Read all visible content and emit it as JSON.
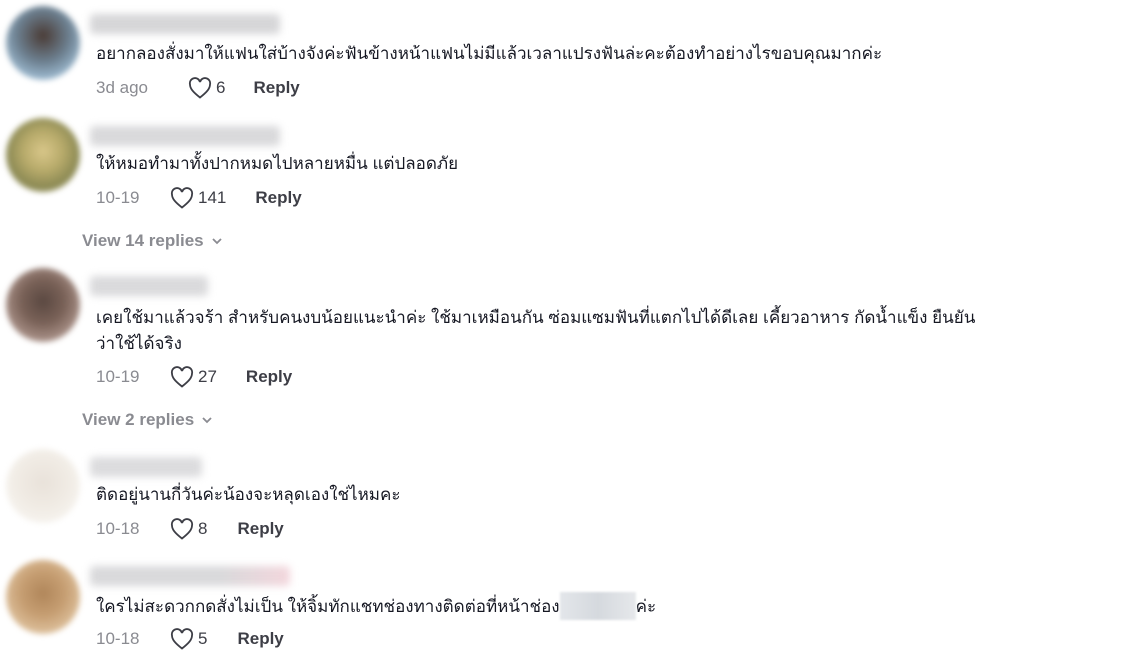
{
  "comments": [
    {
      "text": "อยากลองสั่งมาให้แฟนใส่บ้างจังค่ะฟันข้างหน้าแฟนไม่มีแล้วเวลาแปรงฟันล่ะคะต้องทำอย่างไรขอบคุณมากค่ะ",
      "time": "3d ago",
      "likes": "6",
      "reply_label": "Reply"
    },
    {
      "text": "ให้หมอทำมาทั้งปากหมดไปหลายหมื่น แต่ปลอดภัย",
      "time": "10-19",
      "likes": "141",
      "reply_label": "Reply",
      "view_replies": "View 14 replies"
    },
    {
      "text": "เคยใช้มาแล้วจร้า สำหรับคนงบน้อยแนะนำค่ะ ใช้มาเหมือนกัน ซ่อมแซมฟันที่แตกไปได้ดีเลย เคี้ยวอาหาร กัดน้ำแข็ง ยืนยัน\nว่าใช้ได้จริง",
      "time": "10-19",
      "likes": "27",
      "reply_label": "Reply",
      "view_replies": "View 2 replies"
    },
    {
      "text": "ติดอยู่นานกี่วันค่ะน้องจะหลุดเองใช่ไหมคะ",
      "time": "10-18",
      "likes": "8",
      "reply_label": "Reply"
    },
    {
      "text_before": "ใครไม่สะดวกกดสั่งไม่เป็น ให้จิ้มทักแชทช่องทางติดต่อที่หน้าช่อง",
      "text_after": "ค่ะ",
      "time": "10-18",
      "likes": "5",
      "reply_label": "Reply"
    }
  ],
  "colors": {
    "text": "#161823",
    "muted": "#8a8b91",
    "action": "#3d3e46"
  },
  "icons": {
    "like": "heart-outline-icon",
    "expand": "chevron-down-icon"
  }
}
